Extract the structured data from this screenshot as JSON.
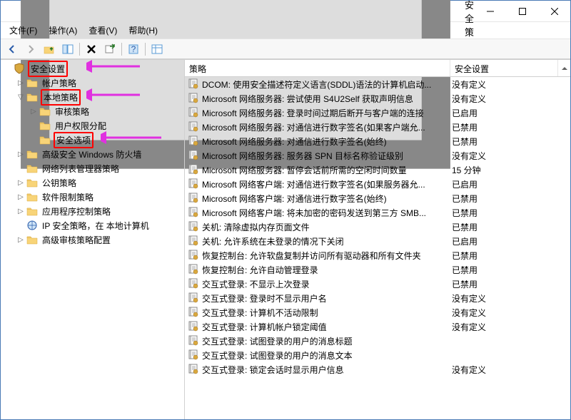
{
  "window": {
    "title": "本地安全策略"
  },
  "menu": {
    "file": "文件(F)",
    "action": "操作(A)",
    "view": "查看(V)",
    "help": "帮助(H)"
  },
  "tree": {
    "root": "安全设置",
    "items": [
      {
        "label": "帐户策略",
        "depth": 1,
        "exp": "▷",
        "hl": false
      },
      {
        "label": "本地策略",
        "depth": 1,
        "exp": "▽",
        "hl": true
      },
      {
        "label": "审核策略",
        "depth": 2,
        "exp": "▷",
        "hl": false
      },
      {
        "label": "用户权限分配",
        "depth": 2,
        "exp": "",
        "hl": false
      },
      {
        "label": "安全选项",
        "depth": 2,
        "exp": "",
        "hl": true
      },
      {
        "label": "高级安全 Windows 防火墙",
        "depth": 1,
        "exp": "▷",
        "hl": false
      },
      {
        "label": "网络列表管理器策略",
        "depth": 1,
        "exp": "",
        "hl": false
      },
      {
        "label": "公钥策略",
        "depth": 1,
        "exp": "▷",
        "hl": false
      },
      {
        "label": "软件限制策略",
        "depth": 1,
        "exp": "▷",
        "hl": false
      },
      {
        "label": "应用程序控制策略",
        "depth": 1,
        "exp": "▷",
        "hl": false
      },
      {
        "label": "IP 安全策略，在 本地计算机",
        "depth": 1,
        "exp": "",
        "hl": false,
        "icon": "ip"
      },
      {
        "label": "高级审核策略配置",
        "depth": 1,
        "exp": "▷",
        "hl": false
      }
    ]
  },
  "columns": {
    "policy": "策略",
    "setting": "安全设置"
  },
  "rows": [
    {
      "p": "DCOM: 使用安全描述符定义语言(SDDL)语法的计算机启动...",
      "s": "没有定义"
    },
    {
      "p": "Microsoft 网络服务器: 尝试使用 S4U2Self 获取声明信息",
      "s": "没有定义"
    },
    {
      "p": "Microsoft 网络服务器: 登录时间过期后断开与客户端的连接",
      "s": "已启用"
    },
    {
      "p": "Microsoft 网络服务器: 对通信进行数字签名(如果客户端允...",
      "s": "已禁用"
    },
    {
      "p": "Microsoft 网络服务器: 对通信进行数字签名(始终)",
      "s": "已禁用"
    },
    {
      "p": "Microsoft 网络服务器: 服务器 SPN 目标名称验证级别",
      "s": "没有定义"
    },
    {
      "p": "Microsoft 网络服务器: 暂停会话前所需的空闲时间数量",
      "s": "15 分钟"
    },
    {
      "p": "Microsoft 网络客户端: 对通信进行数字签名(如果服务器允...",
      "s": "已启用"
    },
    {
      "p": "Microsoft 网络客户端: 对通信进行数字签名(始终)",
      "s": "已禁用"
    },
    {
      "p": "Microsoft 网络客户端: 将未加密的密码发送到第三方 SMB...",
      "s": "已禁用"
    },
    {
      "p": "关机: 清除虚拟内存页面文件",
      "s": "已禁用"
    },
    {
      "p": "关机: 允许系统在未登录的情况下关闭",
      "s": "已启用"
    },
    {
      "p": "恢复控制台: 允许软盘复制并访问所有驱动器和所有文件夹",
      "s": "已禁用"
    },
    {
      "p": "恢复控制台: 允许自动管理登录",
      "s": "已禁用"
    },
    {
      "p": "交互式登录: 不显示上次登录",
      "s": "已禁用"
    },
    {
      "p": "交互式登录: 登录时不显示用户名",
      "s": "没有定义"
    },
    {
      "p": "交互式登录: 计算机不活动限制",
      "s": "没有定义"
    },
    {
      "p": "交互式登录: 计算机帐户锁定阈值",
      "s": "没有定义"
    },
    {
      "p": "交互式登录: 试图登录的用户的消息标题",
      "s": ""
    },
    {
      "p": "交互式登录: 试图登录的用户的消息文本",
      "s": ""
    },
    {
      "p": "交互式登录: 锁定会话时显示用户信息",
      "s": "没有定义"
    }
  ]
}
